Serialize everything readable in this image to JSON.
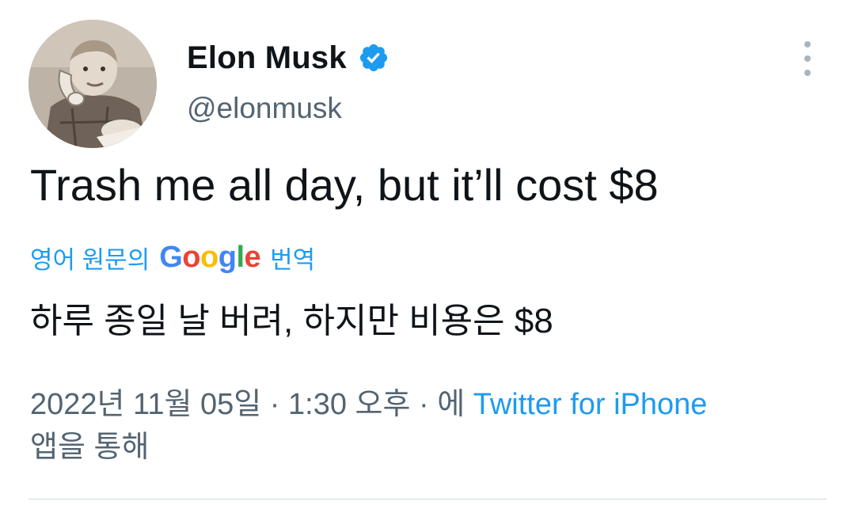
{
  "author": {
    "display_name": "Elon Musk",
    "handle": "@elonmusk",
    "avatar_icon": "profile-photo-child-with-phone",
    "verified_icon": "verified-badge-icon"
  },
  "tweet": {
    "text": "Trash me all day, but it’ll cost $8"
  },
  "translation": {
    "prefix": "영어 원문의",
    "google_logo": [
      "G",
      "o",
      "o",
      "g",
      "l",
      "e"
    ],
    "suffix": "번역",
    "translated_text": "하루 종일 날 버려, 하지만 비용은 $8"
  },
  "meta": {
    "timestamp": "2022년 11월 05일 · 1:30 오후 · 에",
    "source": "Twitter for iPhone",
    "via": "앱을 통해"
  },
  "colors": {
    "accent": "#1d9bf0",
    "text": "#0f1419",
    "secondary": "#536471",
    "divider": "#cfd9de"
  }
}
